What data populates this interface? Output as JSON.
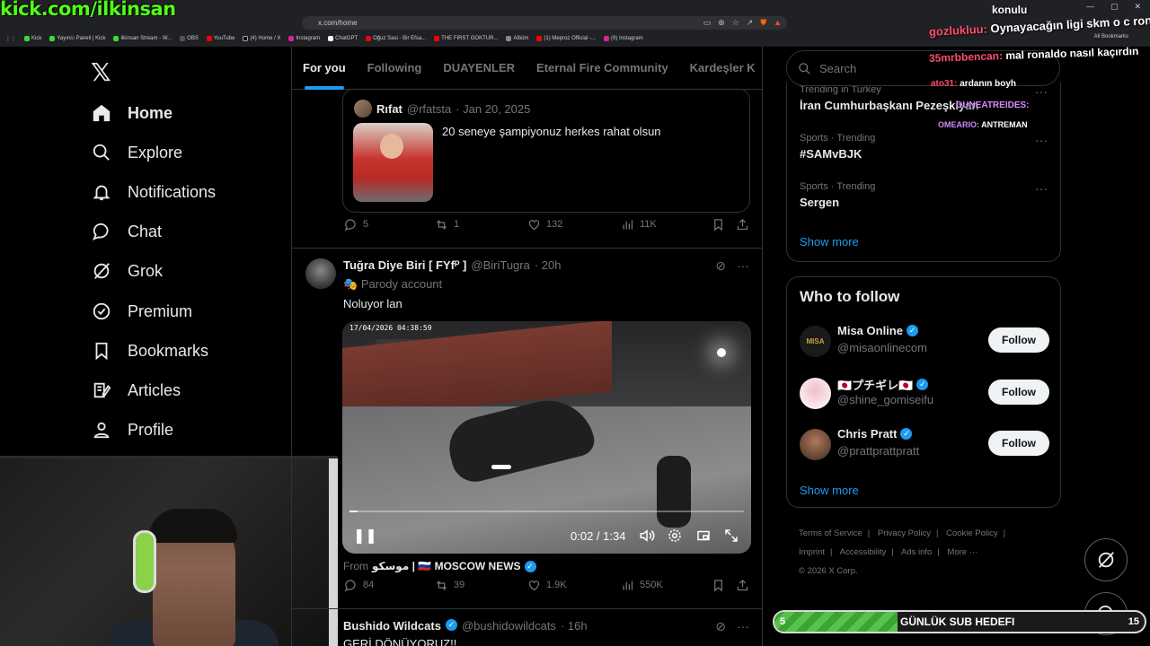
{
  "stream": {
    "watermark": "kick.com/ilkinsan",
    "sub_goal": {
      "label": "GÜNLÜK SUB HEDEFI",
      "current": "5",
      "target": "15",
      "progress": 0.333
    }
  },
  "browser": {
    "url": "x.com/home",
    "bookmarks": [
      "Kick",
      "Yayıncı Paneli | Kick",
      "ilkinsan Stream - W...",
      "OBS",
      "YouTube",
      "(4) Home / X",
      "Instagram",
      "ChatGPT",
      "Oğuz Sasi - Bir Efsa...",
      "THE FIRST GOKTUR...",
      "Albüm",
      "(1) Meproz Official -...",
      "(9) Instagram"
    ],
    "all_bookmarks": "All Bookmarks"
  },
  "nav": {
    "items": [
      {
        "label": "Home",
        "icon": "home-icon"
      },
      {
        "label": "Explore",
        "icon": "search-icon"
      },
      {
        "label": "Notifications",
        "icon": "bell-icon"
      },
      {
        "label": "Chat",
        "icon": "chat-icon"
      },
      {
        "label": "Grok",
        "icon": "grok-icon"
      },
      {
        "label": "Premium",
        "icon": "premium-icon"
      },
      {
        "label": "Bookmarks",
        "icon": "bookmark-icon"
      },
      {
        "label": "Articles",
        "icon": "article-icon"
      },
      {
        "label": "Profile",
        "icon": "profile-icon"
      }
    ]
  },
  "tabs": [
    "For you",
    "Following",
    "DUAYENLER",
    "Eternal Fire Community",
    "Kardeşler K"
  ],
  "quoted": {
    "name": "Rıfat",
    "handle": "@rfatsta",
    "date": "· Jan 20, 2025",
    "text": "20 seneye şampiyonuz herkes rahat olsun"
  },
  "post1_stats": {
    "replies": "5",
    "reposts": "1",
    "likes": "132",
    "views": "11K"
  },
  "post2": {
    "name": "Tuğra Diye Biri [ FYfᴾ ]",
    "handle": "@BiriTugra",
    "time": "· 20h",
    "parody": "Parody account",
    "text": "Noluyor lan",
    "video": {
      "timestamp": "17/04/2026 04:38:59",
      "time": "0:02 / 1:34",
      "progress": 0.02
    },
    "source_prefix": "From",
    "source_name": "موسكو | 🇷🇺 MOSCOW NEWS",
    "stats": {
      "replies": "84",
      "reposts": "39",
      "likes": "1.9K",
      "views": "550K"
    }
  },
  "post3": {
    "name": "Bushido Wildcats",
    "handle": "@bushidowildcats",
    "time": "· 16h",
    "text": "GERİ DÖNÜYORUZ!!"
  },
  "right": {
    "search_placeholder": "Search",
    "trends": [
      {
        "category": "Trending in Turkey",
        "name": "İran Cumhurbaşkanı Pezeşkiyan"
      },
      {
        "category": "Sports · Trending",
        "name": "#SAMvBJK"
      },
      {
        "category": "Sports · Trending",
        "name": "Sergen"
      }
    ],
    "show_more": "Show more",
    "who_to_follow_title": "Who to follow",
    "follow_suggestions": [
      {
        "name": "Misa Online",
        "handle": "@misaonlinecom",
        "avatar_text": "MISA"
      },
      {
        "name": "🇯🇵プチギレ🇯🇵",
        "handle": "@shine_gomiseifu",
        "avatar_text": ""
      },
      {
        "name": "Chris Pratt",
        "handle": "@prattprattpratt",
        "avatar_text": ""
      }
    ],
    "follow_label": "Follow",
    "footer": [
      "Terms of Service",
      "|",
      "Privacy Policy",
      "|",
      "Cookie Policy",
      "|",
      "Imprint",
      "|",
      "Accessibility",
      "|",
      "Ads info",
      "|",
      "More ···",
      "© 2026 X Corp."
    ]
  },
  "chat": [
    {
      "user": "",
      "text": "konulu"
    },
    {
      "user": "gozlukluu:",
      "text": "Oynayacağın ligi skm o c rona"
    },
    {
      "user": "35mrbbencan:",
      "text": "mal ronaldo nasıl kaçırdın"
    },
    {
      "user": "ato31:",
      "text": "ardanın boyh"
    },
    {
      "user": "DUNEATREIDES:",
      "text": ""
    },
    {
      "user": "OMEARIO:",
      "text": "ANTREMAN"
    }
  ]
}
